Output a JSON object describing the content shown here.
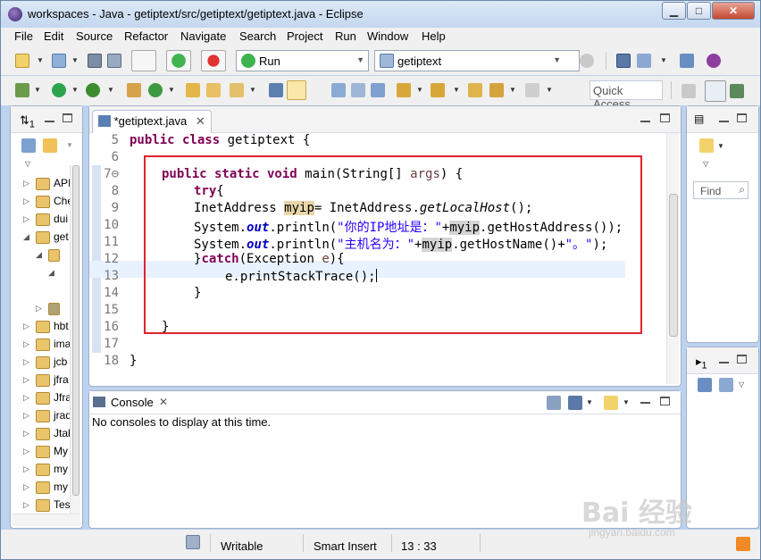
{
  "window": {
    "title": "workspaces - Java - getiptext/src/getiptext/getiptext.java - Eclipse",
    "minimize": "▁",
    "maximize": "□",
    "close": "✕"
  },
  "menu": [
    "File",
    "Edit",
    "Source",
    "Refactor",
    "Navigate",
    "Search",
    "Project",
    "Run",
    "Window",
    "Help"
  ],
  "toolbar": {
    "run_config": "Run",
    "project_selector": "getiptext",
    "quick_access": "Quick Access"
  },
  "package_explorer": {
    "tab_label": "1",
    "items": [
      {
        "label": "API",
        "expanded": false
      },
      {
        "label": "Che",
        "expanded": false
      },
      {
        "label": "dui",
        "expanded": false
      },
      {
        "label": "get",
        "expanded": true
      },
      {
        "label": "",
        "expanded": true
      },
      {
        "label": "",
        "expanded": true
      },
      {
        "label": "",
        "expanded": false
      },
      {
        "label": "hbt",
        "expanded": false
      },
      {
        "label": "ima",
        "expanded": false
      },
      {
        "label": "jcb",
        "expanded": false
      },
      {
        "label": "jfra",
        "expanded": false
      },
      {
        "label": "Jfra",
        "expanded": false
      },
      {
        "label": "jrad",
        "expanded": false
      },
      {
        "label": "Jtab",
        "expanded": false
      },
      {
        "label": "My",
        "expanded": false
      },
      {
        "label": "my",
        "expanded": false
      },
      {
        "label": "my",
        "expanded": false
      },
      {
        "label": "Tes",
        "expanded": false
      }
    ]
  },
  "editor": {
    "tab_label": "*getiptext.java",
    "lines": [
      {
        "n": "5"
      },
      {
        "n": "6"
      },
      {
        "n": "7⊖"
      },
      {
        "n": "8"
      },
      {
        "n": "9"
      },
      {
        "n": "10"
      },
      {
        "n": "11"
      },
      {
        "n": "12"
      },
      {
        "n": "13"
      },
      {
        "n": "14"
      },
      {
        "n": "15"
      },
      {
        "n": "16"
      },
      {
        "n": "17"
      },
      {
        "n": "18"
      }
    ],
    "code": {
      "l5_kw": "public class ",
      "l5_rest": "getiptext {",
      "l7_kw": "public static void ",
      "l7_a": "main(String[] ",
      "l7_param": "args",
      "l7_b": ") {",
      "l8_kw": "try",
      "l8_b": "{",
      "l9_a": "InetAddress ",
      "l9_var": "myip",
      "l9_b": "= InetAddress.",
      "l9_m": "getLocalHost",
      "l9_c": "();",
      "l10_a": "System.",
      "l10_f": "out",
      "l10_b": ".println(",
      "l10_s": "\"你的IP地址是：\"",
      "l10_c": "+",
      "l10_var": "myip",
      "l10_d": ".getHostAddress());",
      "l11_a": "System.",
      "l11_f": "out",
      "l11_b": ".println(",
      "l11_s": "\"主机名为：\"",
      "l11_c": "+",
      "l11_var": "myip",
      "l11_d": ".getHostName()+",
      "l11_s2": "\"。\"",
      "l11_e": ");",
      "l12_a": "}",
      "l12_kw": "catch",
      "l12_b": "(Exception ",
      "l12_param": "e",
      "l12_c": "){",
      "l13": "e.printStackTrace();",
      "l14": "}",
      "l16": "}",
      "l18": "}"
    }
  },
  "outline": {
    "find_placeholder": "Find"
  },
  "tasks": {
    "tab_label": "1"
  },
  "console": {
    "tab_label": "Console",
    "message": "No consoles to display at this time."
  },
  "status": {
    "mode": "Writable",
    "insert": "Smart Insert",
    "position": "13 : 33"
  },
  "watermark": {
    "logo": "Bai 经验",
    "url": "jingyan.baidu.com"
  }
}
